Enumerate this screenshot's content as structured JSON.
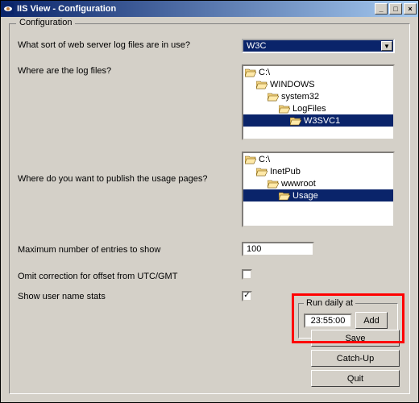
{
  "window": {
    "title": "IIS View - Configuration",
    "min_label": "_",
    "max_label": "□",
    "close_label": "×"
  },
  "group": {
    "legend": "Configuration"
  },
  "rows": {
    "log_type": {
      "label": "What sort of web server log files are in use?",
      "value": "W3C"
    },
    "log_path": {
      "label": "Where are the log files?",
      "tree": [
        {
          "text": "C:\\",
          "depth": 0,
          "open": true,
          "sel": false
        },
        {
          "text": "WINDOWS",
          "depth": 1,
          "open": true,
          "sel": false
        },
        {
          "text": "system32",
          "depth": 2,
          "open": true,
          "sel": false
        },
        {
          "text": "LogFiles",
          "depth": 3,
          "open": true,
          "sel": false
        },
        {
          "text": "W3SVC1",
          "depth": 4,
          "open": true,
          "sel": true
        }
      ]
    },
    "publish_path": {
      "label": "Where do you want to publish the usage pages?",
      "tree": [
        {
          "text": "C:\\",
          "depth": 0,
          "open": true,
          "sel": false
        },
        {
          "text": "InetPub",
          "depth": 1,
          "open": true,
          "sel": false
        },
        {
          "text": "wwwroot",
          "depth": 2,
          "open": true,
          "sel": false
        },
        {
          "text": "Usage",
          "depth": 3,
          "open": true,
          "sel": true
        }
      ]
    },
    "max_entries": {
      "label": "Maximum number of entries to show",
      "value": "100"
    },
    "omit_offset": {
      "label": "Omit correction for offset from  UTC/GMT",
      "checked": false
    },
    "show_user": {
      "label": "Show user name stats",
      "checked": true
    }
  },
  "scheduler": {
    "legend": "Run daily at",
    "time": "23:55:00",
    "add_label": "Add"
  },
  "buttons": {
    "save": "Save",
    "catchup": "Catch-Up",
    "quit": "Quit"
  }
}
